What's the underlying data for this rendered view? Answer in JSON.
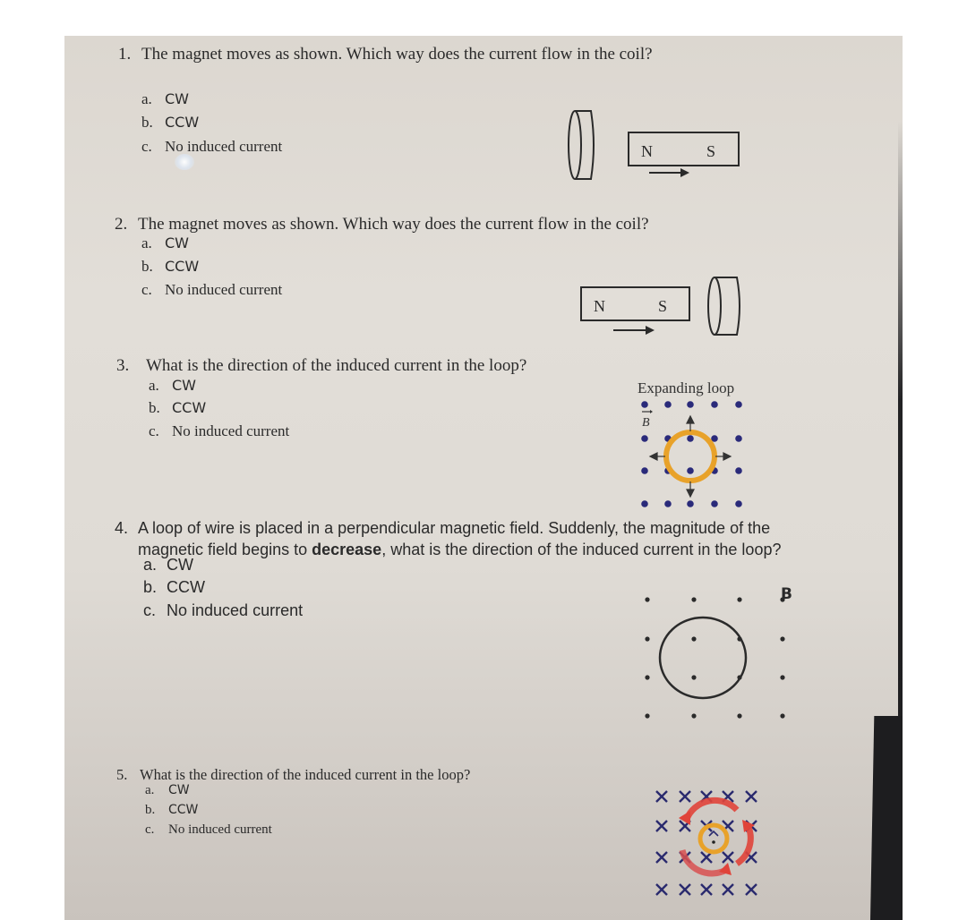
{
  "questions": [
    {
      "number": "1.",
      "text": "The magnet moves as shown. Which way does the current flow in the coil?",
      "options": [
        {
          "letter": "a.",
          "label": "CW"
        },
        {
          "letter": "b.",
          "label": "CCW"
        },
        {
          "letter": "c.",
          "label": "No induced current"
        }
      ],
      "figure": {
        "type": "magnet-and-coil",
        "coil_side": "left",
        "magnet_poles": [
          "N",
          "S"
        ],
        "motion": "right"
      }
    },
    {
      "number": "2.",
      "text": "The magnet moves as shown. Which way does the current flow in the coil?",
      "options": [
        {
          "letter": "a.",
          "label": "CW"
        },
        {
          "letter": "b.",
          "label": "CCW"
        },
        {
          "letter": "c.",
          "label": "No induced current"
        }
      ],
      "figure": {
        "type": "magnet-and-coil",
        "coil_side": "right",
        "magnet_poles": [
          "N",
          "S"
        ],
        "motion": "right"
      }
    },
    {
      "number": "3.",
      "text": "What is the direction of the induced current in the loop?",
      "options": [
        {
          "letter": "a.",
          "label": "CW"
        },
        {
          "letter": "b.",
          "label": "CCW"
        },
        {
          "letter": "c.",
          "label": "No induced current"
        }
      ],
      "figure": {
        "type": "expanding-loop",
        "caption": "Expanding loop",
        "field_label": "B",
        "field_direction": "out-of-page",
        "loop_color": "#e8a22a",
        "dot_color": "#2a2a7a"
      }
    },
    {
      "number": "4.",
      "text_before": "A loop of wire is placed in a perpendicular magnetic field. Suddenly, the magnitude of the",
      "text_line2_before": "magnetic field begins to ",
      "text_bold": "decrease",
      "text_after": ", what is the direction of the induced current in the loop?",
      "options": [
        {
          "letter": "a.",
          "label": "CW"
        },
        {
          "letter": "b.",
          "label": "CCW"
        },
        {
          "letter": "c.",
          "label": "No induced current"
        }
      ],
      "figure": {
        "type": "loop-in-field",
        "field_label": "B",
        "field_direction": "out-of-page"
      }
    },
    {
      "number": "5.",
      "text": "What is the direction of the induced current in the loop?",
      "options": [
        {
          "letter": "a.",
          "label": "CW"
        },
        {
          "letter": "b.",
          "label": "CCW"
        },
        {
          "letter": "c.",
          "label": "No induced current"
        }
      ],
      "figure": {
        "type": "rotating-field-loop",
        "field_direction": "into-page",
        "cross_color": "#2a2a6e",
        "loop_color": "#e8a22a",
        "arrow_color": "#e0443a"
      }
    }
  ]
}
